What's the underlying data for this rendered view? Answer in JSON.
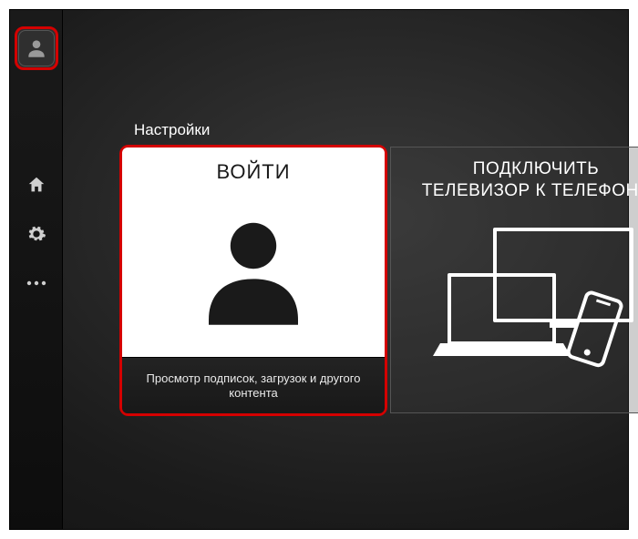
{
  "section_title": "Настройки",
  "sidebar": {
    "avatar_icon": "account-icon",
    "items": [
      {
        "name": "home-icon"
      },
      {
        "name": "gear-icon"
      },
      {
        "name": "more-icon"
      }
    ]
  },
  "cards": {
    "login": {
      "title": "ВОЙТИ",
      "caption": "Просмотр подписок, загрузок и другого контента"
    },
    "connect": {
      "title_line1": "ПОДКЛЮЧИТЬ",
      "title_line2": "ТЕЛЕВИЗОР К ТЕЛЕФОНУ"
    }
  },
  "colors": {
    "highlight": "#d40000"
  }
}
